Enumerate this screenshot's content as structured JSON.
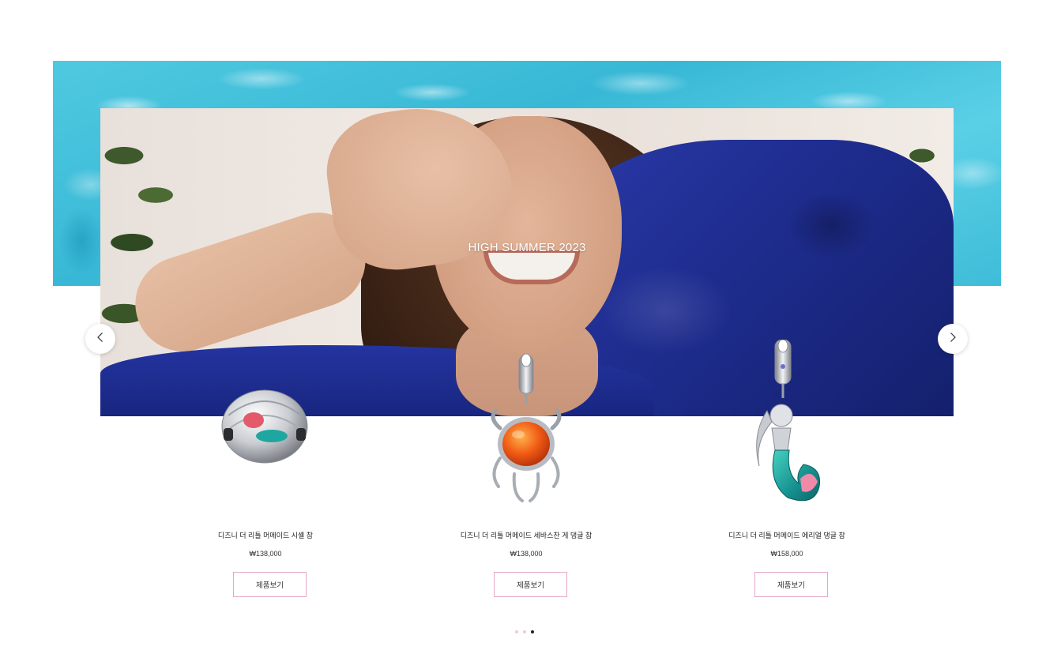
{
  "hero": {
    "title": "HIGH SUMMER 2023"
  },
  "carousel": {
    "prev_icon": "chevron-left-icon",
    "next_icon": "chevron-right-icon",
    "dots": [
      {
        "active": false
      },
      {
        "active": false
      },
      {
        "active": true
      }
    ]
  },
  "products": [
    {
      "name": "디즈니 더 리틀 머메이드 시셸 참",
      "price": "₩138,000",
      "button_label": "제품보기"
    },
    {
      "name": "디즈니 더 리틀 머메이드 세바스찬 게 댕글 참",
      "price": "₩138,000",
      "button_label": "제품보기"
    },
    {
      "name": "디즈니 더 리틀 머메이드 에리얼 댕글 참",
      "price": "₩158,000",
      "button_label": "제품보기"
    }
  ],
  "colors": {
    "button_border": "#e7a6c6",
    "dot_inactive": "#f4c6dc",
    "dot_active": "#222222",
    "water": "#3fbcd8",
    "dress_blue": "#1e2c8e"
  }
}
